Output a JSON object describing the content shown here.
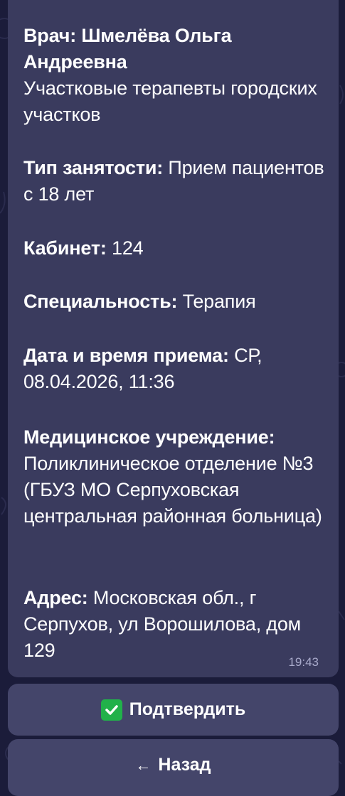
{
  "message": {
    "doctor_label": "Врач:",
    "doctor_name": "Шмелёва Ольга Андреевна",
    "doctor_dept": "Участковые терапевты городских участков",
    "employment_label": "Тип занятости:",
    "employment_value": "Прием пациентов с 18 лет",
    "room_label": "Кабинет:",
    "room_value": "124",
    "specialty_label": "Специальность:",
    "specialty_value": "Терапия",
    "datetime_label": "Дата и время приема:",
    "datetime_value": "СР, 08.04.2026, 11:36",
    "facility_label": "Медицинское учреждение:",
    "facility_value": "Поликлиническое отделение №3 (ГБУЗ МО Серпуховская центральная районная больница)",
    "address_label": "Адрес:",
    "address_value": "Московская обл., г Серпухов, ул Ворошилова, дом 129",
    "time": "19:43"
  },
  "buttons": {
    "confirm_label": "Подтвердить",
    "back_label": "Назад",
    "back_arrow": "←"
  },
  "colors": {
    "background": "#1b1c3a",
    "bubble": "#3a3b5e",
    "button": "#44456a",
    "check_green": "#21b14a"
  },
  "icons": {
    "confirm": "check-mark-icon",
    "back": "left-arrow-icon"
  }
}
